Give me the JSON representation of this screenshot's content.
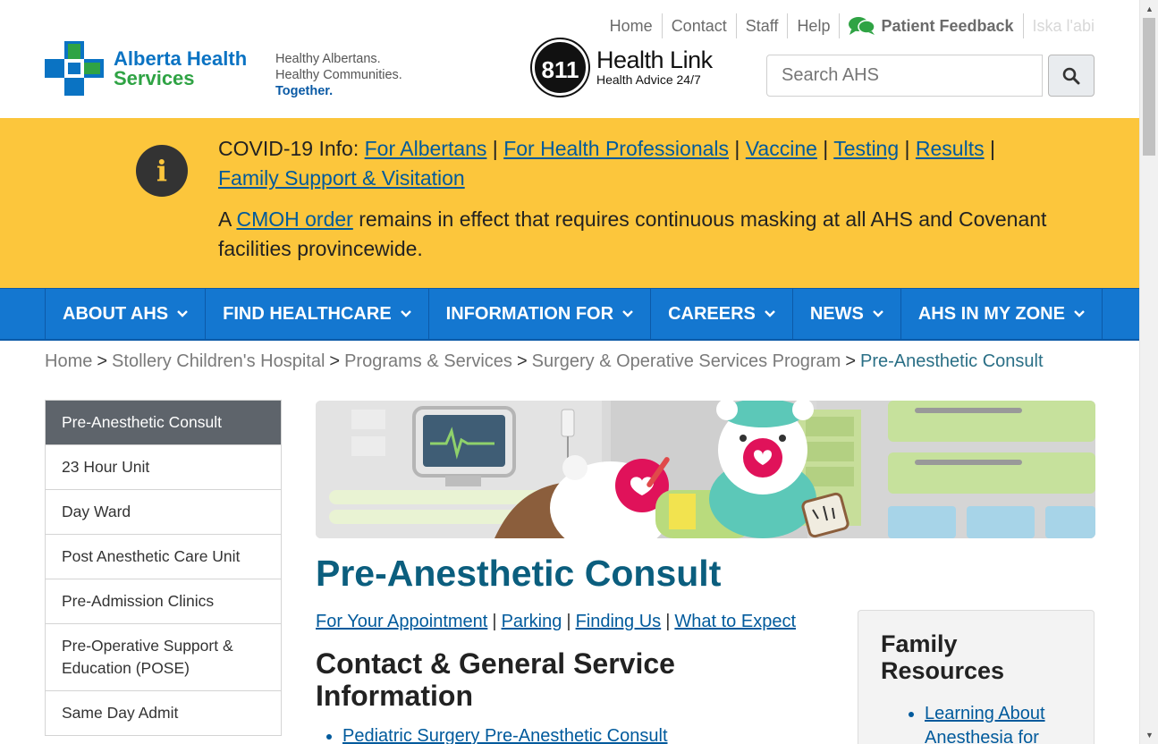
{
  "header": {
    "utility_links": [
      "Home",
      "Contact",
      "Staff",
      "Help"
    ],
    "feedback_label": "Patient Feedback",
    "language_label": "Iska l'abi",
    "logo": {
      "line1": "Alberta Health",
      "line2": "Services"
    },
    "tagline": {
      "line1": "Healthy Albertans.",
      "line2": "Healthy Communities.",
      "line3": "Together."
    },
    "healthlink": {
      "number": "811",
      "title": "Health Link",
      "subtitle": "Health Advice 24/7"
    },
    "search": {
      "placeholder": "Search AHS"
    }
  },
  "covid": {
    "intro": "COVID-19 Info:",
    "links": [
      "For Albertans",
      "For Health Professionals",
      "Vaccine",
      "Testing",
      "Results",
      "Family Support & Visitation"
    ],
    "notice_before": "A",
    "notice_link": "CMOH order",
    "notice_after": "remains in effect that requires continuous masking at all AHS and Covenant facilities provincewide."
  },
  "nav": {
    "items": [
      "ABOUT AHS",
      "FIND HEALTHCARE",
      "INFORMATION FOR",
      "CAREERS",
      "NEWS",
      "AHS IN MY ZONE"
    ]
  },
  "breadcrumb": {
    "items": [
      "Home",
      "Stollery Children's Hospital",
      "Programs & Services",
      "Surgery & Operative Services Program"
    ],
    "current": "Pre-Anesthetic Consult"
  },
  "sidebar": {
    "items": [
      "Pre-Anesthetic Consult",
      "23 Hour Unit",
      "Day Ward",
      "Post Anesthetic Care Unit",
      "Pre-Admission Clinics",
      "Pre-Operative Support & Education (POSE)",
      "Same Day Admit"
    ]
  },
  "main": {
    "title": "Pre-Anesthetic Consult",
    "quick_links": [
      "For Your Appointment",
      "Parking",
      "Finding Us",
      "What to Expect"
    ],
    "section_title": "Contact & General Service Information",
    "contact_items": [
      "Pediatric Surgery Pre-Anesthetic Consult"
    ]
  },
  "family": {
    "title": "Family Resources",
    "items": [
      "Learning About Anesthesia for"
    ]
  },
  "colors": {
    "banner": "#fcc63c",
    "nav": "#1477d0",
    "link": "#005a9c",
    "title": "#0b5e7e",
    "sidebar_active": "#5e646b"
  }
}
